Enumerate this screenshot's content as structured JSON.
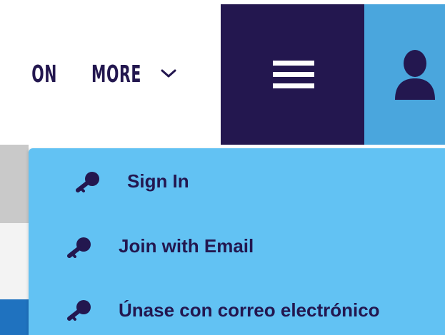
{
  "nav": {
    "partial_item": "ON",
    "more_label": "MORE"
  },
  "icons": {
    "chevron": "chevron-down-icon",
    "menu": "hamburger-icon",
    "user": "user-icon",
    "key": "key-icon"
  },
  "dropdown": {
    "items": [
      {
        "label": "Sign In"
      },
      {
        "label": "Join with Email"
      },
      {
        "label": "Únase con correo electrónico"
      }
    ]
  },
  "colors": {
    "navy": "#23174f",
    "user_blue": "#4aa6dd",
    "dropdown_blue": "#62c2f3"
  }
}
